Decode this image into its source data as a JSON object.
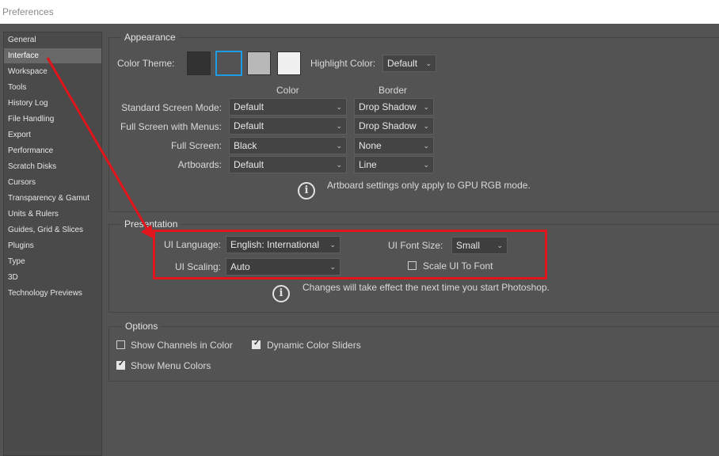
{
  "window": {
    "title": "Preferences"
  },
  "sidebar": {
    "items": [
      {
        "label": "General",
        "selected": false
      },
      {
        "label": "Interface",
        "selected": true
      },
      {
        "label": "Workspace",
        "selected": false
      },
      {
        "label": "Tools",
        "selected": false
      },
      {
        "label": "History Log",
        "selected": false
      },
      {
        "label": "File Handling",
        "selected": false
      },
      {
        "label": "Export",
        "selected": false
      },
      {
        "label": "Performance",
        "selected": false
      },
      {
        "label": "Scratch Disks",
        "selected": false
      },
      {
        "label": "Cursors",
        "selected": false
      },
      {
        "label": "Transparency & Gamut",
        "selected": false
      },
      {
        "label": "Units & Rulers",
        "selected": false
      },
      {
        "label": "Guides, Grid & Slices",
        "selected": false
      },
      {
        "label": "Plugins",
        "selected": false
      },
      {
        "label": "Type",
        "selected": false
      },
      {
        "label": "3D",
        "selected": false
      },
      {
        "label": "Technology Previews",
        "selected": false
      }
    ]
  },
  "appearance": {
    "title": "Appearance",
    "color_theme_label": "Color Theme:",
    "themes": [
      {
        "name": "darkest",
        "color": "#323232",
        "selected": false
      },
      {
        "name": "dark",
        "color": "#535353",
        "selected": true
      },
      {
        "name": "medium",
        "color": "#b8b8b8",
        "selected": false
      },
      {
        "name": "light",
        "color": "#f0f0f0",
        "selected": false
      }
    ],
    "highlight_label": "Highlight Color:",
    "highlight_value": "Default",
    "col_color": "Color",
    "col_border": "Border",
    "rows": [
      {
        "label": "Standard Screen Mode:",
        "color": "Default",
        "border": "Drop Shadow"
      },
      {
        "label": "Full Screen with Menus:",
        "color": "Default",
        "border": "Drop Shadow"
      },
      {
        "label": "Full Screen:",
        "color": "Black",
        "border": "None"
      },
      {
        "label": "Artboards:",
        "color": "Default",
        "border": "Line"
      }
    ],
    "note": "Artboard settings only apply to GPU RGB mode."
  },
  "presentation": {
    "title": "Presentation",
    "ui_language_label": "UI Language:",
    "ui_language_value": "English: International",
    "ui_font_size_label": "UI Font Size:",
    "ui_font_size_value": "Small",
    "ui_scaling_label": "UI Scaling:",
    "ui_scaling_value": "Auto",
    "scale_ui_label": "Scale UI To Font",
    "scale_ui_checked": false,
    "note": "Changes will take effect the next time you start Photoshop."
  },
  "options": {
    "title": "Options",
    "show_channels_label": "Show Channels in Color",
    "show_channels_checked": false,
    "dynamic_sliders_label": "Dynamic Color Sliders",
    "dynamic_sliders_checked": true,
    "show_menu_colors_label": "Show Menu Colors",
    "show_menu_colors_checked": true
  },
  "annotation": {
    "color": "#e0141b"
  }
}
